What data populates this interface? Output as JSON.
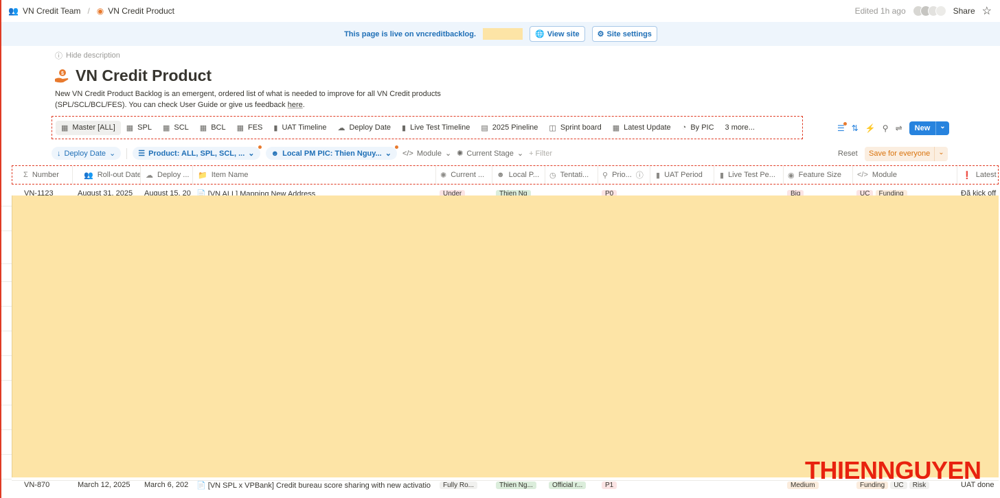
{
  "breadcrumb": {
    "team": "VN Credit Team",
    "page": "VN Credit Product"
  },
  "top": {
    "edited": "Edited 1h ago",
    "share": "Share"
  },
  "banner": {
    "text": "This page is live on vncreditbacklog.",
    "view_site": "View site",
    "site_settings": "Site settings"
  },
  "header": {
    "hide_description": "Hide description",
    "title": "VN Credit Product",
    "description_line1": "New VN Credit Product Backlog is an emergent, ordered list of what is needed to improve for all VN Credit products",
    "description_line2": "(SPL/SCL/BCL/FES). You can check User Guide or give us feedback ",
    "description_link": "here",
    "description_end": "."
  },
  "views": {
    "tabs": [
      {
        "label": "Master [ALL]",
        "icon": "table-icon"
      },
      {
        "label": "SPL",
        "icon": "table-icon"
      },
      {
        "label": "SCL",
        "icon": "table-icon"
      },
      {
        "label": "BCL",
        "icon": "table-icon"
      },
      {
        "label": "FES",
        "icon": "table-icon"
      },
      {
        "label": "UAT Timeline",
        "icon": "timeline-icon"
      },
      {
        "label": "Deploy Date",
        "icon": "cloud-upload-icon"
      },
      {
        "label": "Live Test Timeline",
        "icon": "timeline-icon"
      },
      {
        "label": "2025 Pineline",
        "icon": "gantt-icon"
      },
      {
        "label": "Sprint board",
        "icon": "board-icon"
      },
      {
        "label": "Latest Update",
        "icon": "table-icon"
      },
      {
        "label": "By PIC",
        "icon": "chart-icon"
      }
    ],
    "more": "3 more...",
    "new_label": "New"
  },
  "filters": {
    "sort": "Deploy Date",
    "product": "Product: ALL, SPL, SCL, ...",
    "pic": "Local PM PIC: Thien Nguy...",
    "module": "Module",
    "stage": "Current Stage",
    "add_filter": "+ Filter",
    "reset": "Reset",
    "save": "Save for everyone"
  },
  "columns": [
    {
      "label": "Number",
      "icon": "sigma-icon"
    },
    {
      "label": "Roll-out Date",
      "icon": "people-icon"
    },
    {
      "label": "Deploy ...",
      "icon": "cloud-upload-icon"
    },
    {
      "label": "Item Name",
      "icon": "folder-icon"
    },
    {
      "label": "Current ...",
      "icon": "loading-icon"
    },
    {
      "label": "Local P...",
      "icon": "person-icon"
    },
    {
      "label": "Tentati...",
      "icon": "clock-icon"
    },
    {
      "label": "Prio...",
      "icon": "pin-icon"
    },
    {
      "label": "UAT Period",
      "icon": "timeline-icon"
    },
    {
      "label": "Live Test Pe...",
      "icon": "timeline-icon"
    },
    {
      "label": "Feature Size",
      "icon": "select-icon"
    },
    {
      "label": "Module",
      "icon": "code-icon"
    },
    {
      "label": "Latest s",
      "icon": "alert-icon"
    }
  ],
  "row_first": {
    "number": "VN-1123",
    "rollout": "August 31, 2025",
    "deploy": "August 15, 20",
    "item": "[VN ALL] Mapping New Address",
    "stage": "Under",
    "local_pm": "Thien Ng",
    "prio": "P0",
    "size": "Big",
    "module1": "UC",
    "module2": "Funding",
    "latest": "Đã kick off"
  },
  "row_last": {
    "number": "VN-870",
    "rollout": "March 12, 2025",
    "deploy": "March 6, 202",
    "item": "[VN SPL x VPBank] Credit bureau score sharing with new activatio",
    "stage": "Fully Ro...",
    "local_pm": "Thien Ng...",
    "tentative": "Official r...",
    "prio": "P1",
    "size": "Medium",
    "module1": "Funding",
    "module2": "UC",
    "module3": "Risk",
    "latest": "UAT done"
  },
  "watermark": "THIENNGUYEN",
  "colors": {
    "accent": "#2783de",
    "mask": "#fde4a6",
    "annotation": "#e03b24",
    "watermark": "#e8220f"
  }
}
